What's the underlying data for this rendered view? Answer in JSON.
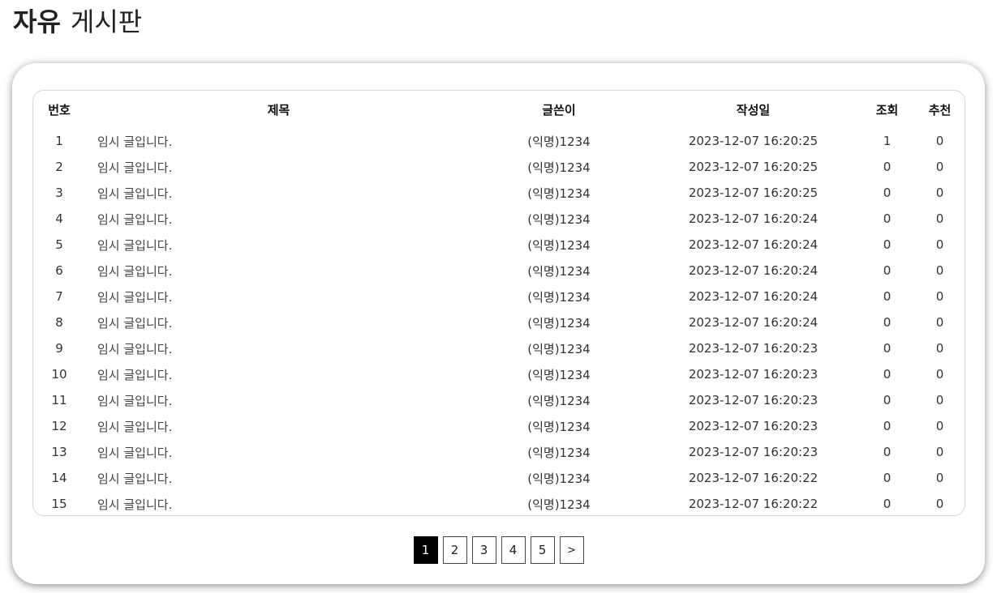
{
  "header": {
    "title_bold": "자유",
    "title_rest": "게시판"
  },
  "table": {
    "columns": [
      "번호",
      "제목",
      "글쓴이",
      "작성일",
      "조회",
      "추천"
    ],
    "rows": [
      {
        "no": "1",
        "title": "임시 글입니다.",
        "writer": "(익명)1234",
        "date": "2023-12-07 16:20:25",
        "views": "1",
        "rec": "0"
      },
      {
        "no": "2",
        "title": "임시 글입니다.",
        "writer": "(익명)1234",
        "date": "2023-12-07 16:20:25",
        "views": "0",
        "rec": "0"
      },
      {
        "no": "3",
        "title": "임시 글입니다.",
        "writer": "(익명)1234",
        "date": "2023-12-07 16:20:25",
        "views": "0",
        "rec": "0"
      },
      {
        "no": "4",
        "title": "임시 글입니다.",
        "writer": "(익명)1234",
        "date": "2023-12-07 16:20:24",
        "views": "0",
        "rec": "0"
      },
      {
        "no": "5",
        "title": "임시 글입니다.",
        "writer": "(익명)1234",
        "date": "2023-12-07 16:20:24",
        "views": "0",
        "rec": "0"
      },
      {
        "no": "6",
        "title": "임시 글입니다.",
        "writer": "(익명)1234",
        "date": "2023-12-07 16:20:24",
        "views": "0",
        "rec": "0"
      },
      {
        "no": "7",
        "title": "임시 글입니다.",
        "writer": "(익명)1234",
        "date": "2023-12-07 16:20:24",
        "views": "0",
        "rec": "0"
      },
      {
        "no": "8",
        "title": "임시 글입니다.",
        "writer": "(익명)1234",
        "date": "2023-12-07 16:20:24",
        "views": "0",
        "rec": "0"
      },
      {
        "no": "9",
        "title": "임시 글입니다.",
        "writer": "(익명)1234",
        "date": "2023-12-07 16:20:23",
        "views": "0",
        "rec": "0"
      },
      {
        "no": "10",
        "title": "임시 글입니다.",
        "writer": "(익명)1234",
        "date": "2023-12-07 16:20:23",
        "views": "0",
        "rec": "0"
      },
      {
        "no": "11",
        "title": "임시 글입니다.",
        "writer": "(익명)1234",
        "date": "2023-12-07 16:20:23",
        "views": "0",
        "rec": "0"
      },
      {
        "no": "12",
        "title": "임시 글입니다.",
        "writer": "(익명)1234",
        "date": "2023-12-07 16:20:23",
        "views": "0",
        "rec": "0"
      },
      {
        "no": "13",
        "title": "임시 글입니다.",
        "writer": "(익명)1234",
        "date": "2023-12-07 16:20:23",
        "views": "0",
        "rec": "0"
      },
      {
        "no": "14",
        "title": "임시 글입니다.",
        "writer": "(익명)1234",
        "date": "2023-12-07 16:20:22",
        "views": "0",
        "rec": "0"
      },
      {
        "no": "15",
        "title": "임시 글입니다.",
        "writer": "(익명)1234",
        "date": "2023-12-07 16:20:22",
        "views": "0",
        "rec": "0"
      }
    ]
  },
  "pagination": {
    "pages": [
      "1",
      "2",
      "3",
      "4",
      "5"
    ],
    "current": "1",
    "next_label": ">"
  },
  "colors": {
    "active_page_bg": "#000000",
    "card_bg": "#ffffff"
  }
}
